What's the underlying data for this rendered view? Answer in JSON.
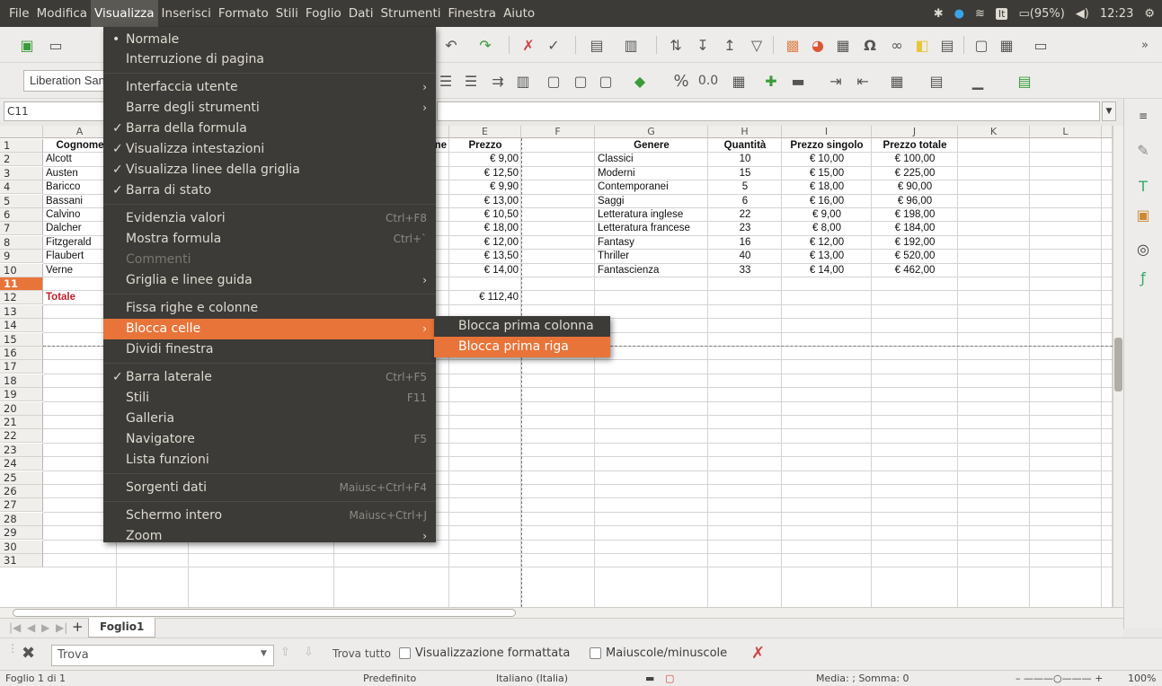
{
  "menubar": {
    "items": [
      "File",
      "Modifica",
      "Visualizza",
      "Inserisci",
      "Formato",
      "Stili",
      "Foglio",
      "Dati",
      "Strumenti",
      "Finestra",
      "Aiuto"
    ],
    "indicators": {
      "battery": "(95%)",
      "lang": "It",
      "time": "12:23"
    }
  },
  "toolbar": {
    "font_name": "Liberation Sans",
    "percent": "%",
    "decimal": "0.0"
  },
  "formula": {
    "cell_ref": "C11"
  },
  "grid": {
    "columns": [
      "A",
      "E",
      "F",
      "G",
      "H",
      "I",
      "J",
      "K",
      "L"
    ],
    "rows": [
      "1",
      "2",
      "3",
      "4",
      "5",
      "6",
      "7",
      "8",
      "9",
      "10",
      "11",
      "12",
      "13",
      "14",
      "15",
      "16",
      "17",
      "18",
      "19",
      "20",
      "21",
      "22",
      "23",
      "24",
      "25",
      "26",
      "27",
      "28",
      "29",
      "30",
      "31"
    ],
    "colA": [
      "Cognome",
      "Alcott",
      "Austen",
      "Baricco",
      "Bassani",
      "Calvino",
      "Dalcher",
      "Fitzgerald",
      "Flaubert",
      "Verne",
      "",
      "Totale"
    ],
    "partial_d_header": "ne",
    "colE": [
      "Prezzo",
      "€ 9,00",
      "€ 12,50",
      "€ 9,90",
      "€ 13,00",
      "€ 10,50",
      "€ 18,00",
      "€ 12,00",
      "€ 13,50",
      "€ 14,00",
      "",
      "€ 112,40"
    ],
    "colG": [
      "Genere",
      "Classici",
      "Moderni",
      "Contemporanei",
      "Saggi",
      "Letteratura inglese",
      "Letteratura francese",
      "Fantasy",
      "Thriller",
      "Fantascienza"
    ],
    "colH": [
      "Quantità",
      "10",
      "15",
      "5",
      "6",
      "22",
      "23",
      "16",
      "40",
      "33"
    ],
    "colI": [
      "Prezzo singolo",
      "€ 10,00",
      "€ 15,00",
      "€ 18,00",
      "€ 16,00",
      "€ 9,00",
      "€ 8,00",
      "€ 12,00",
      "€ 13,00",
      "€ 14,00"
    ],
    "colJ": [
      "Prezzo totale",
      "€ 100,00",
      "€ 225,00",
      "€ 90,00",
      "€ 96,00",
      "€ 198,00",
      "€ 184,00",
      "€ 192,00",
      "€ 520,00",
      "€ 462,00"
    ]
  },
  "menu": {
    "items": [
      {
        "label": "Normale",
        "check": "•",
        "acc": "",
        "arrow": ""
      },
      {
        "label": "Interruzione di pagina",
        "check": "",
        "acc": "",
        "arrow": ""
      },
      {
        "label": "Interfaccia utente",
        "check": "",
        "acc": "",
        "arrow": "›"
      },
      {
        "label": "Barre degli strumenti",
        "check": "",
        "acc": "",
        "arrow": "›"
      },
      {
        "label": "Barra della formula",
        "check": "✓",
        "acc": "",
        "arrow": ""
      },
      {
        "label": "Visualizza intestazioni",
        "check": "✓",
        "acc": "",
        "arrow": ""
      },
      {
        "label": "Visualizza linee della griglia",
        "check": "✓",
        "acc": "",
        "arrow": ""
      },
      {
        "label": "Barra di stato",
        "check": "✓",
        "acc": "",
        "arrow": ""
      },
      {
        "label": "Evidenzia valori",
        "check": "",
        "acc": "Ctrl+F8",
        "arrow": ""
      },
      {
        "label": "Mostra formula",
        "check": "",
        "acc": "Ctrl+`",
        "arrow": ""
      },
      {
        "label": "Commenti",
        "check": "",
        "acc": "",
        "arrow": ""
      },
      {
        "label": "Griglia e linee guida",
        "check": "",
        "acc": "",
        "arrow": "›"
      },
      {
        "label": "Fissa righe e colonne",
        "check": "",
        "acc": "",
        "arrow": ""
      },
      {
        "label": "Blocca celle",
        "check": "",
        "acc": "",
        "arrow": "›"
      },
      {
        "label": "Dividi finestra",
        "check": "",
        "acc": "",
        "arrow": ""
      },
      {
        "label": "Barra laterale",
        "check": "✓",
        "acc": "Ctrl+F5",
        "arrow": ""
      },
      {
        "label": "Stili",
        "check": "",
        "acc": "F11",
        "arrow": ""
      },
      {
        "label": "Galleria",
        "check": "",
        "acc": "",
        "arrow": ""
      },
      {
        "label": "Navigatore",
        "check": "",
        "acc": "F5",
        "arrow": ""
      },
      {
        "label": "Lista funzioni",
        "check": "",
        "acc": "",
        "arrow": ""
      },
      {
        "label": "Sorgenti dati",
        "check": "",
        "acc": "Maiusc+Ctrl+F4",
        "arrow": ""
      },
      {
        "label": "Schermo intero",
        "check": "",
        "acc": "Maiusc+Ctrl+J",
        "arrow": ""
      },
      {
        "label": "Zoom",
        "check": "",
        "acc": "",
        "arrow": "›"
      }
    ],
    "submenu": [
      "Blocca prima colonna",
      "Blocca prima riga"
    ]
  },
  "tabs": {
    "sheet": "Foglio1"
  },
  "findbar": {
    "placeholder": "Trova",
    "find_all": "Trova tutto",
    "formatted": "Visualizzazione formattata",
    "case": "Maiuscole/minuscole"
  },
  "status": {
    "sheet": "Foglio 1 di 1",
    "style": "Predefinito",
    "lang": "Italiano (Italia)",
    "sum": "Media: ; Somma: 0",
    "zoom": "100%"
  }
}
